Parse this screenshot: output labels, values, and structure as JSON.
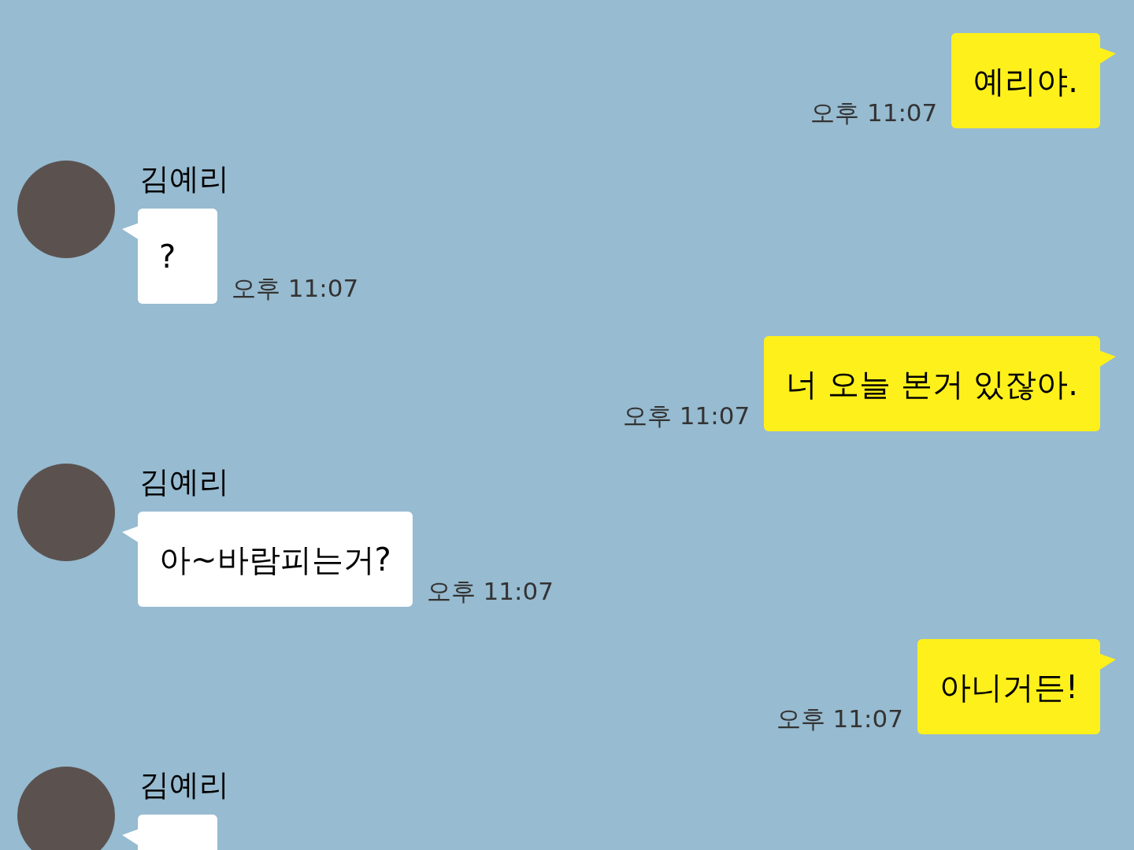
{
  "messages": [
    {
      "kind": "sent",
      "text": "예리야.",
      "time": "오후 11:07"
    },
    {
      "kind": "received",
      "name": "김예리",
      "text": "?",
      "time": "오후 11:07"
    },
    {
      "kind": "sent",
      "text": "너 오늘 본거 있잖아.",
      "time": "오후 11:07"
    },
    {
      "kind": "received",
      "name": "김예리",
      "text": "아~바람피는거?",
      "time": "오후 11:07"
    },
    {
      "kind": "sent",
      "text": "아니거든!",
      "time": "오후 11:07"
    },
    {
      "kind": "received",
      "name": "김예리"
    }
  ]
}
